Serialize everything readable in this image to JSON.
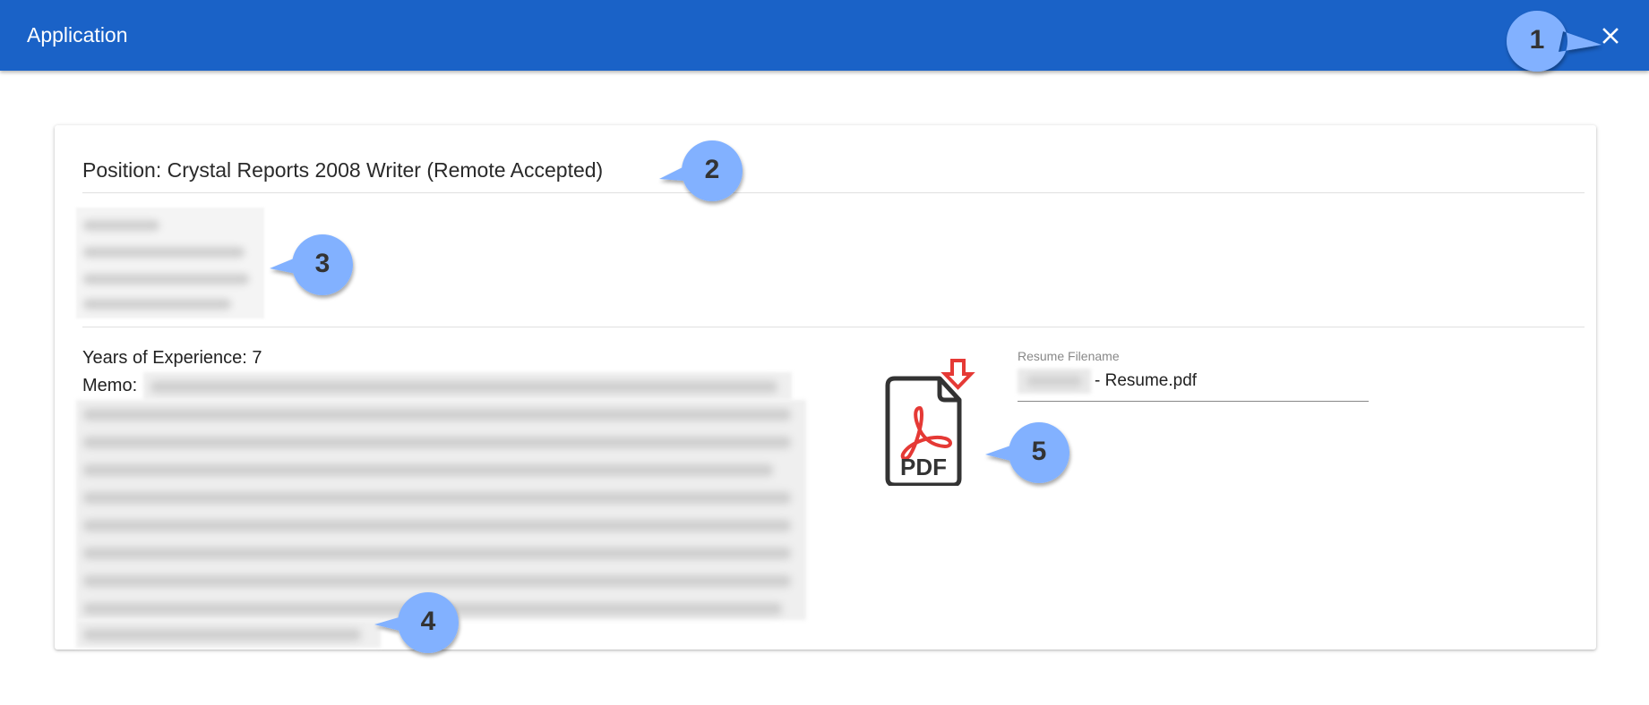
{
  "appbar": {
    "title": "Application",
    "close_icon": "close-icon"
  },
  "card": {
    "position_title": "Position: Crystal Reports 2008 Writer (Remote Accepted)",
    "address_redacted": true,
    "experience_line": "Years of Experience: 7",
    "memo_label": "Memo:",
    "memo_redacted": true
  },
  "resume": {
    "icon": "pdf-download-icon",
    "pdf_label": "PDF",
    "field_label": "Resume Filename",
    "value_suffix": "- Resume.pdf",
    "value_prefix_redacted": true
  },
  "annotations": [
    {
      "number": "1",
      "target": "close-button"
    },
    {
      "number": "2",
      "target": "position-title"
    },
    {
      "number": "3",
      "target": "applicant-address"
    },
    {
      "number": "4",
      "target": "memo"
    },
    {
      "number": "5",
      "target": "resume-pdf"
    }
  ],
  "colors": {
    "appbar": "#1a62c7",
    "callout_fill": "#82b1ff",
    "pdf_red": "#e53935"
  }
}
